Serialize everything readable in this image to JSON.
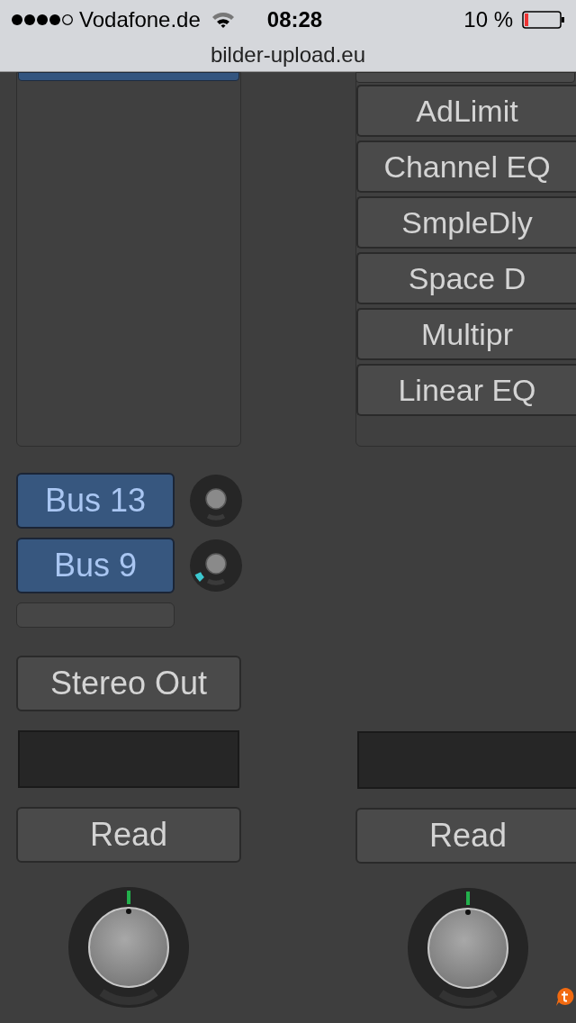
{
  "status_bar": {
    "carrier": "Vodafone.de",
    "time": "08:28",
    "battery": "10 %",
    "url": "bilder-upload.eu"
  },
  "left_channel": {
    "sends": [
      {
        "label": "Bus 13"
      },
      {
        "label": "Bus 9"
      }
    ],
    "output": "Stereo Out",
    "automation": "Read"
  },
  "right_channel": {
    "inserts": [
      "AdLimit",
      "Channel EQ",
      "SmpleDly",
      "Space D",
      "Multipr",
      "Linear EQ"
    ],
    "automation": "Read"
  }
}
